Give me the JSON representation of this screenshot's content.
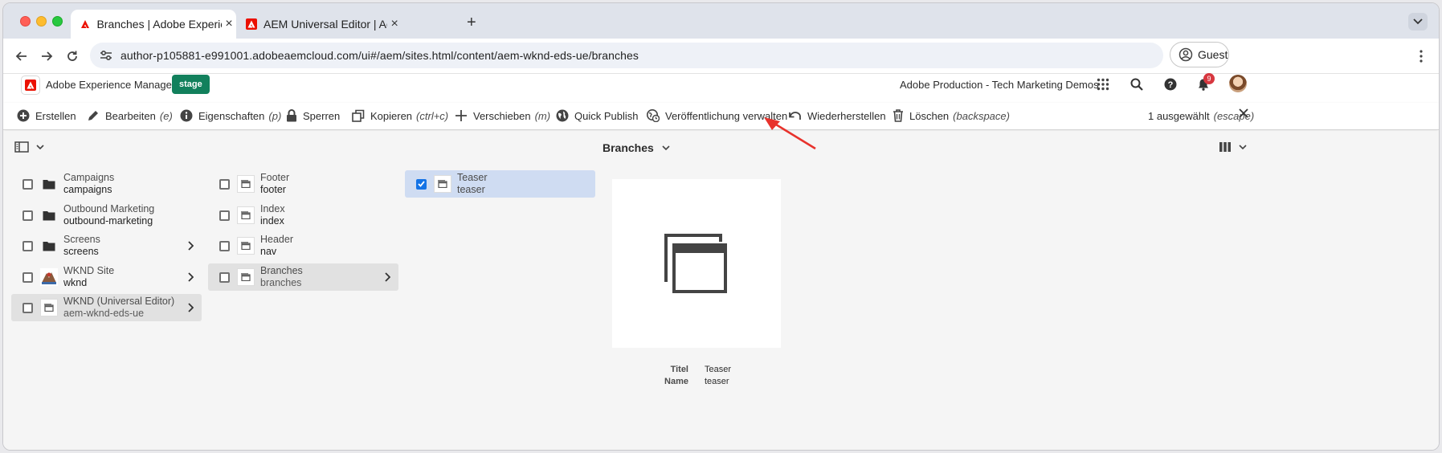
{
  "browser": {
    "tabs": [
      {
        "title": "Branches | Adobe Experience Manager",
        "active": true
      },
      {
        "title": "AEM Universal Editor | Adobe Experience Manager",
        "active": false
      }
    ],
    "url": "author-p105881-e991001.adobeaemcloud.com/ui#/aem/sites.html/content/aem-wknd-eds-ue/branches",
    "profile": "Guest"
  },
  "header": {
    "product": "Adobe Experience Manager",
    "environment": "stage",
    "org": "Adobe Production - Tech Marketing Demos",
    "notification_count": "9"
  },
  "actionbar": {
    "create": "Erstellen",
    "edit": "Bearbeiten",
    "edit_key": "(e)",
    "properties": "Eigenschaften",
    "properties_key": "(p)",
    "lock": "Sperren",
    "copy": "Kopieren",
    "copy_key": "(ctrl+c)",
    "move": "Verschieben",
    "move_key": "(m)",
    "quick_publish": "Quick Publish",
    "manage_publication": "Veröffentlichung verwalten",
    "restore": "Wiederherstellen",
    "delete": "Löschen",
    "delete_key": "(backspace)",
    "selected": "1 ausgewählt",
    "selected_key": "(escape)"
  },
  "column_view": {
    "title": "Branches",
    "col1": [
      {
        "title": "Campaigns",
        "name": "campaigns"
      },
      {
        "title": "Outbound Marketing",
        "name": "outbound-marketing"
      },
      {
        "title": "Screens",
        "name": "screens"
      },
      {
        "title": "WKND Site",
        "name": "wknd"
      },
      {
        "title": "WKND (Universal Editor)",
        "name": "aem-wknd-eds-ue"
      }
    ],
    "col2": [
      {
        "title": "Footer",
        "name": "footer"
      },
      {
        "title": "Index",
        "name": "index"
      },
      {
        "title": "Header",
        "name": "nav"
      },
      {
        "title": "Branches",
        "name": "branches"
      }
    ],
    "col3": [
      {
        "title": "Teaser",
        "name": "teaser"
      }
    ]
  },
  "preview": {
    "title_label": "Titel",
    "title_value": "Teaser",
    "name_label": "Name",
    "name_value": "teaser"
  },
  "colors": {
    "stage": "#12805c",
    "selection": "#cfdcf2",
    "checkbox": "#1473e6",
    "annotation_arrow": "#e8322c"
  }
}
